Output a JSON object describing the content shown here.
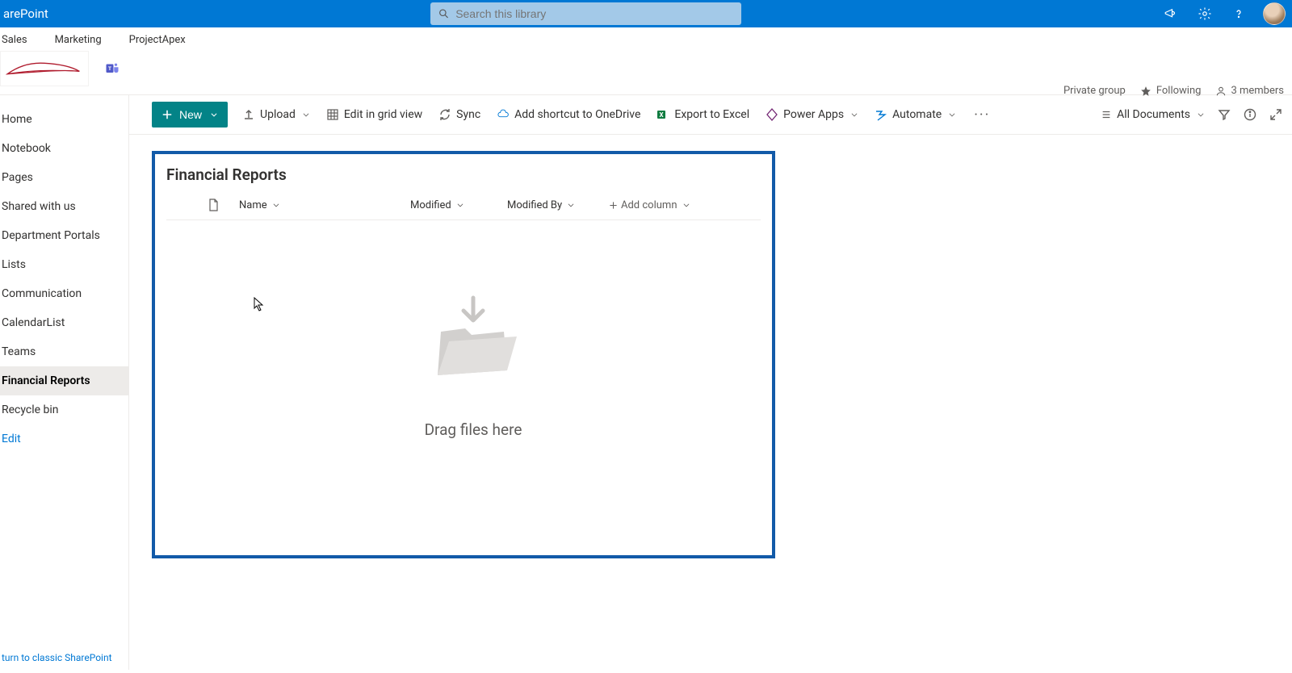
{
  "header": {
    "brand": "arePoint",
    "search_placeholder": "Search this library"
  },
  "top_nav": [
    "Sales",
    "Marketing",
    "ProjectApex"
  ],
  "site_info": {
    "private_label": "Private group",
    "following_label": "Following",
    "members_label": "3 members"
  },
  "left_nav": {
    "items": [
      {
        "label": "Home",
        "selected": false
      },
      {
        "label": "Notebook",
        "selected": false
      },
      {
        "label": "Pages",
        "selected": false
      },
      {
        "label": "Shared with us",
        "selected": false
      },
      {
        "label": "Department Portals",
        "selected": false
      },
      {
        "label": "Lists",
        "selected": false
      },
      {
        "label": "Communication",
        "selected": false
      },
      {
        "label": "CalendarList",
        "selected": false
      },
      {
        "label": "Teams",
        "selected": false
      },
      {
        "label": "Financial Reports",
        "selected": true
      },
      {
        "label": "Recycle bin",
        "selected": false
      }
    ],
    "edit_label": "Edit",
    "footer": "turn to classic SharePoint"
  },
  "command_bar": {
    "new_label": "New",
    "upload_label": "Upload",
    "grid_label": "Edit in grid view",
    "sync_label": "Sync",
    "shortcut_label": "Add shortcut to OneDrive",
    "export_label": "Export to Excel",
    "powerapps_label": "Power Apps",
    "automate_label": "Automate",
    "view_label": "All Documents"
  },
  "library": {
    "title": "Financial Reports",
    "columns": {
      "name": "Name",
      "modified": "Modified",
      "modified_by": "Modified By",
      "add_column": "Add column"
    },
    "empty_message": "Drag files here"
  }
}
